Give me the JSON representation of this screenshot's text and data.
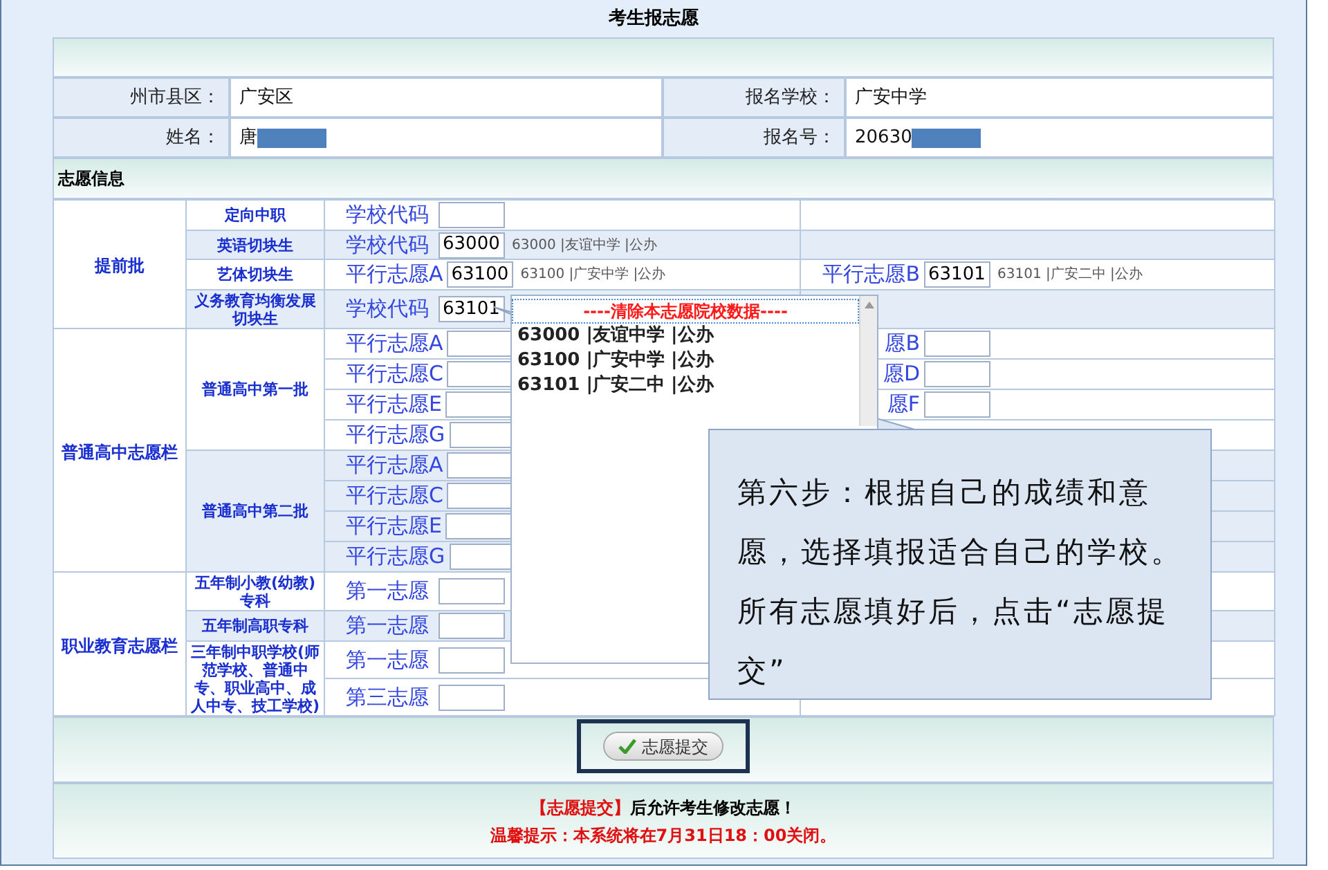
{
  "title": "考生报志愿",
  "student_info": [
    {
      "label": "州市县区：",
      "value": "广安区",
      "redacted": false
    },
    {
      "label": "报名学校：",
      "value": "广安中学",
      "redacted": false
    },
    {
      "label": "姓名：",
      "value": "唐",
      "redacted": true
    },
    {
      "label": "报名号：",
      "value": "20630",
      "redacted": true
    }
  ],
  "section_title": "志愿信息",
  "groups": [
    {
      "name": "提前批",
      "subgroups": [
        {
          "name": "定向中职",
          "rows": [
            {
              "fields": [
                {
                  "label": "学校代码"
                }
              ]
            }
          ]
        },
        {
          "name": "英语切块生",
          "rows": [
            {
              "fields": [
                {
                  "label": "学校代码",
                  "value": "63000",
                  "school": "63000 |友谊中学 |公办"
                }
              ]
            }
          ]
        },
        {
          "name": "艺体切块生",
          "rows": [
            {
              "fields": [
                {
                  "label": "平行志愿A",
                  "value": "63100",
                  "school": "63100 |广安中学 |公办"
                },
                {
                  "label": "平行志愿B",
                  "value": "63101",
                  "school": "63101 |广安二中 |公办"
                }
              ]
            }
          ]
        },
        {
          "name": "义务教育均衡发展切块生",
          "rows": [
            {
              "fields": [
                {
                  "label": "学校代码",
                  "value": "63101"
                }
              ]
            }
          ]
        }
      ]
    },
    {
      "name": "普通高中志愿栏",
      "subgroups": [
        {
          "name": "普通高中第一批",
          "rows": [
            {
              "fields": [
                {
                  "label": "平行志愿A"
                },
                {
                  "label": "愿B"
                }
              ]
            },
            {
              "fields": [
                {
                  "label": "平行志愿C"
                },
                {
                  "label": "愿D"
                }
              ]
            },
            {
              "fields": [
                {
                  "label": "平行志愿E"
                },
                {
                  "label": "愿F"
                }
              ]
            },
            {
              "fields": [
                {
                  "label": "平行志愿G"
                }
              ]
            }
          ]
        },
        {
          "name": "普通高中第二批",
          "rows": [
            {
              "fields": [
                {
                  "label": "平行志愿A"
                }
              ]
            },
            {
              "fields": [
                {
                  "label": "平行志愿C"
                }
              ]
            },
            {
              "fields": [
                {
                  "label": "平行志愿E"
                }
              ]
            },
            {
              "fields": [
                {
                  "label": "平行志愿G"
                }
              ]
            }
          ]
        }
      ]
    },
    {
      "name": "职业教育志愿栏",
      "subgroups": [
        {
          "name": "五年制小教(幼教)专科",
          "rows": [
            {
              "fields": [
                {
                  "label": "第一志愿"
                }
              ]
            }
          ]
        },
        {
          "name": "五年制高职专科",
          "rows": [
            {
              "fields": [
                {
                  "label": "第一志愿"
                }
              ]
            }
          ]
        },
        {
          "name": "三年制中职学校(师范学校、普通中专、职业高中、成人中专、技工学校)",
          "rows": [
            {
              "fields": [
                {
                  "label": "第一志愿"
                }
              ]
            },
            {
              "fields": [
                {
                  "label": "第三志愿"
                }
              ]
            }
          ]
        }
      ]
    }
  ],
  "dropdown": {
    "options": [
      {
        "label": "----清除本志愿院校数据----",
        "kind": "clear",
        "selected": true
      },
      {
        "label": "63000 |友谊中学 |公办",
        "kind": "school",
        "selected": false
      },
      {
        "label": "63100 |广安中学 |公办",
        "kind": "school",
        "selected": false
      },
      {
        "label": "63101 |广安二中 |公办",
        "kind": "school",
        "selected": false
      }
    ]
  },
  "callout": {
    "text": "第六步：根据自己的成绩和意愿，选择填报适合自己的学校。所有志愿填好后，点击“志愿提交”"
  },
  "submit_button": "志愿提交",
  "notice": {
    "highlight": "【志愿提交】",
    "text": "后允许考生修改志愿！"
  },
  "tip": "温馨提示：本系统将在7月31日18：00关闭。"
}
